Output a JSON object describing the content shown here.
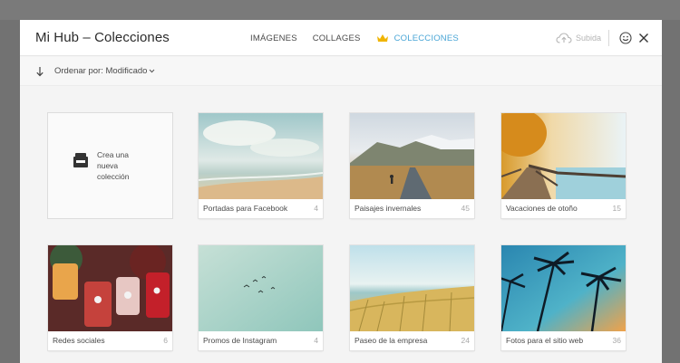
{
  "window": {
    "title": "Mi Hub – Colecciones"
  },
  "nav": {
    "tabs": [
      {
        "label": "IMÁGENES"
      },
      {
        "label": "COLLAGES"
      },
      {
        "label": "COLECCIONES",
        "active": true,
        "icon": "crown-icon"
      }
    ]
  },
  "tools": {
    "upload_label": "Subida"
  },
  "toolbar": {
    "sort_label": "Ordenar por: Modificado"
  },
  "new_collection": {
    "line1": "Crea una",
    "line2": "nueva",
    "line3": "colección"
  },
  "collections": [
    {
      "name": "Portadas para Facebook",
      "count": "4"
    },
    {
      "name": "Paisajes invernales",
      "count": "45"
    },
    {
      "name": "Vacaciones de otoño",
      "count": "15"
    },
    {
      "name": "Redes sociales",
      "count": "6"
    },
    {
      "name": "Promos de Instagram",
      "count": "4"
    },
    {
      "name": "Paseo de la empresa",
      "count": "24"
    },
    {
      "name": "Fotos para el sitio web",
      "count": "36"
    }
  ],
  "colors": {
    "accent": "#4aa6d6",
    "crown": "#f0b400"
  }
}
